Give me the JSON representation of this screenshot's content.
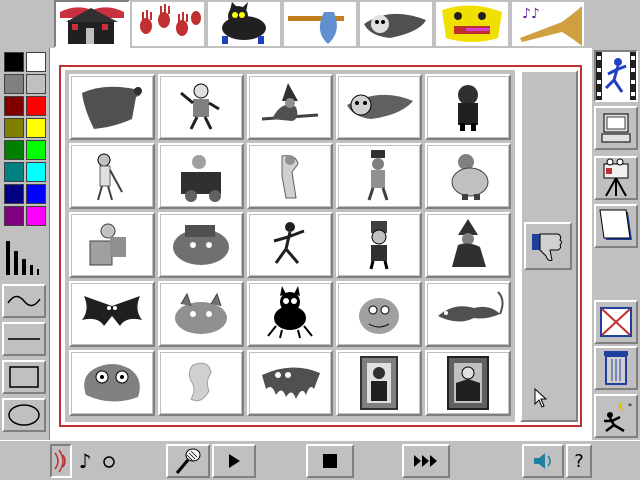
{
  "top_toolbar": {
    "categories": [
      {
        "name": "haunted-house",
        "icon": "haunted-house-icon"
      },
      {
        "name": "hand-prints",
        "icon": "handprints-icon"
      },
      {
        "name": "black-cat",
        "icon": "cat-icon"
      },
      {
        "name": "axe",
        "icon": "axe-icon"
      },
      {
        "name": "flying-skull",
        "icon": "skull-icon"
      },
      {
        "name": "monster-face",
        "icon": "monster-icon"
      },
      {
        "name": "music-horn",
        "icon": "horn-icon"
      }
    ],
    "active_index": 0
  },
  "palette": {
    "colors": [
      [
        "#000000",
        "#ffffff"
      ],
      [
        "#808080",
        "#c0c0c0"
      ],
      [
        "#800000",
        "#ff0000"
      ],
      [
        "#808000",
        "#ffff00"
      ],
      [
        "#008000",
        "#00ff00"
      ],
      [
        "#008080",
        "#00ffff"
      ],
      [
        "#000080",
        "#0000ff"
      ],
      [
        "#800080",
        "#ff00ff"
      ]
    ],
    "tools": [
      "line-width-icon",
      "curve-icon",
      "line-icon",
      "rectangle-icon",
      "ellipse-icon"
    ]
  },
  "stamps": {
    "rows": [
      [
        "ghost-stamp",
        "mummy-stamp",
        "witch-broom-stamp",
        "flying-skull-stamp",
        "ghoul-stamp"
      ],
      [
        "skeleton-cane-stamp",
        "wheelchair-mummy-stamp",
        "bony-ghost-stamp",
        "top-hat-ghoul-stamp",
        "fat-ghoul-stamp"
      ],
      [
        "armchair-ghost-stamp",
        "blob-monster-stamp",
        "dancing-skeleton-stamp",
        "frankenstein-stamp",
        "crouching-witch-stamp"
      ],
      [
        "bat-stamp",
        "gargoyle-stamp",
        "scared-cat-stamp",
        "hairy-monster-stamp",
        "leaping-rat-stamp"
      ],
      [
        "slime-monster-stamp",
        "wispy-ghost-stamp",
        "dripping-ghost-stamp",
        "framed-dracula-stamp",
        "framed-vampire-stamp"
      ]
    ],
    "side_button_icon": "thumbs-down-icon"
  },
  "right_toolbar": {
    "tools": [
      "dancer-animation-icon",
      "computer-icon",
      "movie-camera-icon",
      "paper-icon",
      "erase-picture-icon",
      "trash-can-icon",
      "night-runner-icon"
    ]
  },
  "bottom_bar": {
    "buttons": [
      "sound-wave-icon",
      "music-note-icon",
      "circle-icon",
      "microphone-icon",
      "play-icon",
      "stop-icon",
      "fast-forward-icon",
      "speaker-icon",
      "help-icon"
    ],
    "help_label": "?"
  }
}
